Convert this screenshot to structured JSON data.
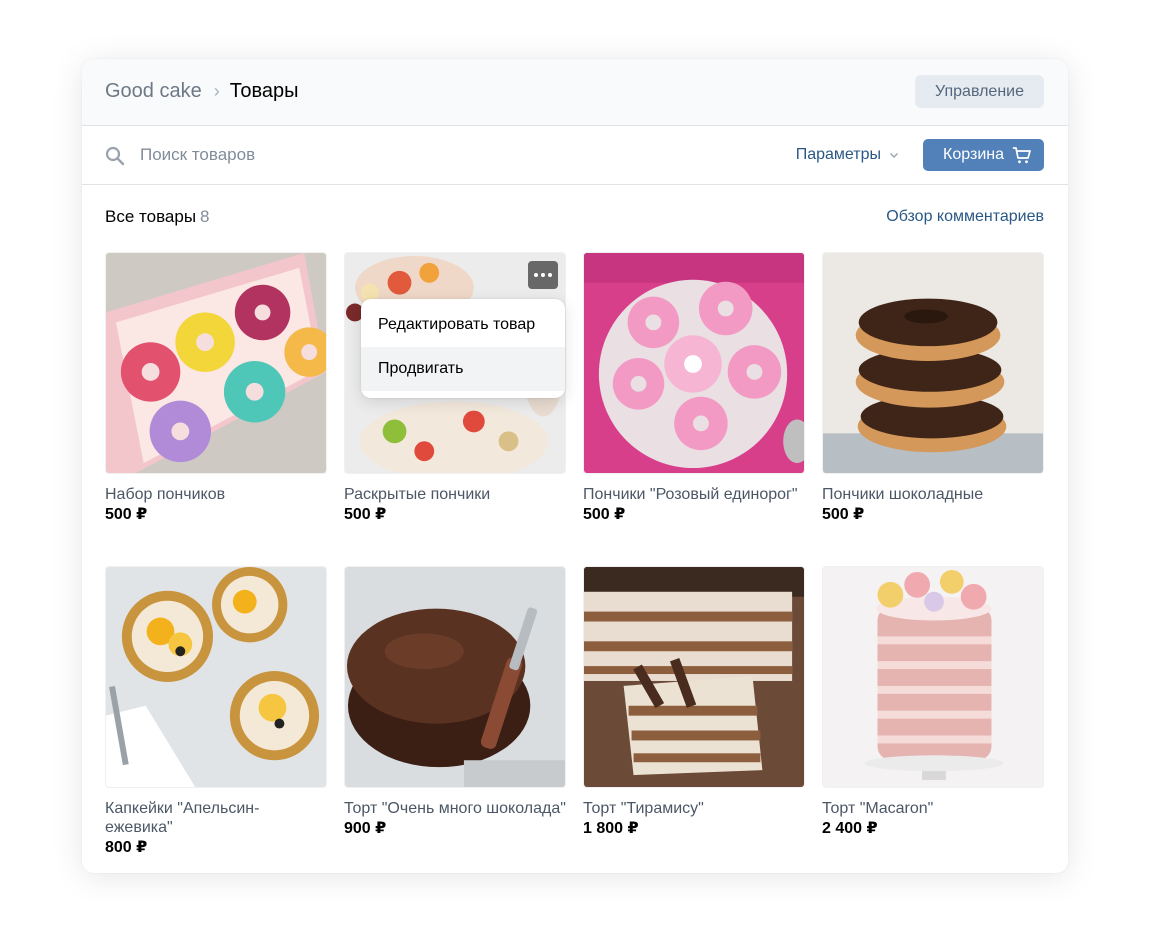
{
  "header": {
    "shop_name": "Good cake",
    "separator": "›",
    "current_page": "Товары",
    "manage_button": "Управление"
  },
  "toolbar": {
    "search_placeholder": "Поиск товаров",
    "params_label": "Параметры",
    "cart_label": "Корзина"
  },
  "section": {
    "title": "Все товары",
    "count": "8",
    "comments_link": "Обзор комментариев"
  },
  "products": [
    {
      "name": "Набор пончиков",
      "price": "500 ₽"
    },
    {
      "name": "Раскрытые пончики",
      "price": "500 ₽"
    },
    {
      "name": "Пончики \"Розовый единорог\"",
      "price": "500 ₽"
    },
    {
      "name": "Пончики шоколадные",
      "price": "500 ₽"
    },
    {
      "name": "Капкейки \"Апельсин-ежевика\"",
      "price": "800 ₽"
    },
    {
      "name": "Торт \"Очень много шоколада\"",
      "price": "900 ₽"
    },
    {
      "name": "Торт \"Тирамису\"",
      "price": "1 800 ₽"
    },
    {
      "name": "Торт \"Macaron\"",
      "price": "2 400 ₽"
    }
  ],
  "context_menu": {
    "items": [
      {
        "label": "Редактировать товар"
      },
      {
        "label": "Продвигать"
      }
    ]
  },
  "colors": {
    "accent": "#5181b8",
    "link": "#2a5885",
    "secondary_button": "#e5ebf1"
  },
  "icons": {
    "search": "search-icon",
    "cart": "cart-icon",
    "more": "more-icon",
    "chevron": "chevron-down-icon"
  }
}
